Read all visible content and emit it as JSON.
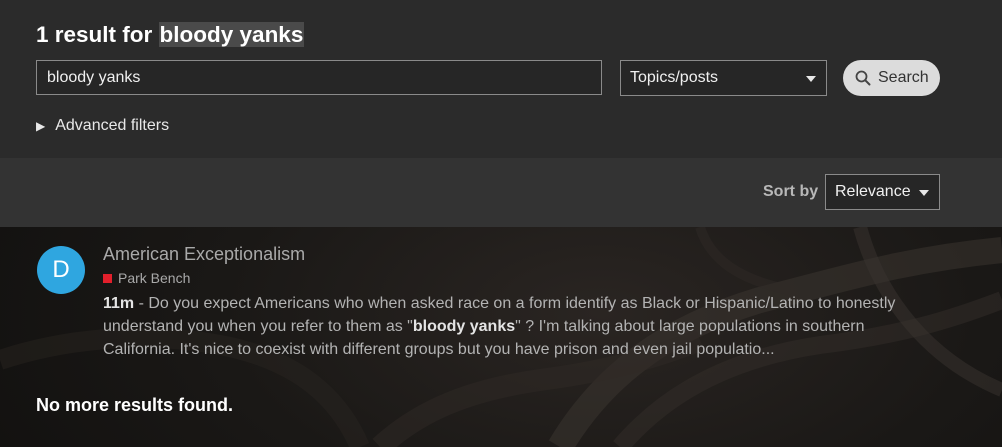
{
  "header": {
    "title_prefix": "1 result for",
    "title_term": "bloody yanks"
  },
  "search": {
    "query": "bloody yanks",
    "type_selected": "Topics/posts",
    "button_label": "Search",
    "advanced_filters_label": "Advanced filters"
  },
  "sort": {
    "label": "Sort by",
    "selected": "Relevance"
  },
  "results": [
    {
      "avatar_letter": "D",
      "avatar_color": "#2fa6e0",
      "title": "American Exceptionalism",
      "category": "Park Bench",
      "category_color": "#e21f2b",
      "age": "11m",
      "separator": " - ",
      "blurb_before": "Do you expect Americans who when asked race on a form identify as Black or Hispanic/Latino to honestly understand you when you refer to them as \"",
      "blurb_highlight": "bloody yanks",
      "blurb_after": "\" ? I'm talking about large populations in southern California. It's nice to coexist with different groups but you have prison and even jail populatio..."
    }
  ],
  "footer": {
    "no_more": "No more results found."
  }
}
